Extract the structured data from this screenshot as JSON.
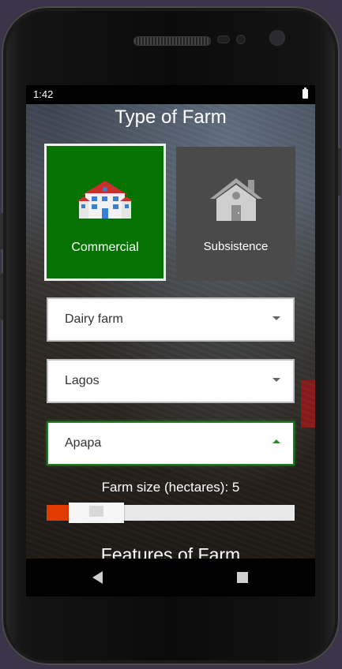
{
  "status_bar": {
    "time": "1:42"
  },
  "app": {
    "title": "Type of Farm",
    "farm_types": [
      {
        "label": "Commercial",
        "icon": "commercial-building-icon",
        "selected": true,
        "color": "#047302"
      },
      {
        "label": "Subsistence",
        "icon": "house-icon",
        "selected": false,
        "color": "#4a4a4a"
      }
    ],
    "dropdowns": {
      "farm_category": {
        "value": "Dairy farm"
      },
      "state": {
        "value": "Lagos"
      },
      "lga": {
        "value": "Apapa",
        "expanded": true
      }
    },
    "farm_size": {
      "label": "Farm size (hectares): 5",
      "value": 5,
      "fill_fraction": 0.2,
      "accent": "#e03c00"
    },
    "features_title": "Features of Farm"
  },
  "nav_bar": {
    "back_icon": "back-triangle-icon",
    "recents_icon": "recents-square-icon"
  }
}
